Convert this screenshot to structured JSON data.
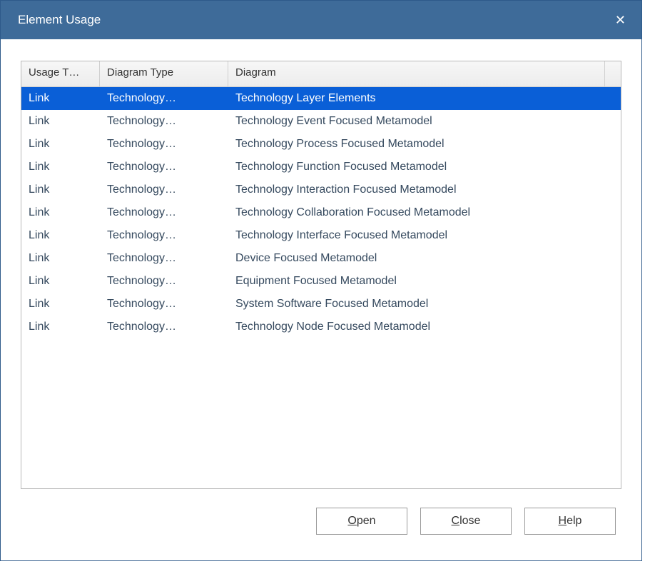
{
  "dialog": {
    "title": "Element Usage",
    "close_icon": "✕"
  },
  "table": {
    "columns": [
      {
        "label": "Usage T…"
      },
      {
        "label": "Diagram Type"
      },
      {
        "label": "Diagram"
      }
    ],
    "rows": [
      {
        "usage": "Link",
        "diagram_type": "Technology…",
        "diagram": "Technology Layer Elements",
        "selected": true
      },
      {
        "usage": "Link",
        "diagram_type": "Technology…",
        "diagram": "Technology Event Focused Metamodel",
        "selected": false
      },
      {
        "usage": "Link",
        "diagram_type": "Technology…",
        "diagram": "Technology Process Focused Metamodel",
        "selected": false
      },
      {
        "usage": "Link",
        "diagram_type": "Technology…",
        "diagram": "Technology Function Focused Metamodel",
        "selected": false
      },
      {
        "usage": "Link",
        "diagram_type": "Technology…",
        "diagram": "Technology Interaction Focused Metamodel",
        "selected": false
      },
      {
        "usage": "Link",
        "diagram_type": "Technology…",
        "diagram": "Technology Collaboration Focused Metamodel",
        "selected": false
      },
      {
        "usage": "Link",
        "diagram_type": "Technology…",
        "diagram": "Technology Interface Focused Metamodel",
        "selected": false
      },
      {
        "usage": "Link",
        "diagram_type": "Technology…",
        "diagram": "Device Focused Metamodel",
        "selected": false
      },
      {
        "usage": "Link",
        "diagram_type": "Technology…",
        "diagram": "Equipment Focused Metamodel",
        "selected": false
      },
      {
        "usage": "Link",
        "diagram_type": "Technology…",
        "diagram": "System Software Focused Metamodel",
        "selected": false
      },
      {
        "usage": "Link",
        "diagram_type": "Technology…",
        "diagram": "Technology Node Focused Metamodel",
        "selected": false
      }
    ]
  },
  "buttons": {
    "open": {
      "pre": "",
      "accel": "O",
      "post": "pen"
    },
    "close": {
      "pre": "",
      "accel": "C",
      "post": "lose"
    },
    "help": {
      "pre": "",
      "accel": "H",
      "post": "elp"
    }
  }
}
